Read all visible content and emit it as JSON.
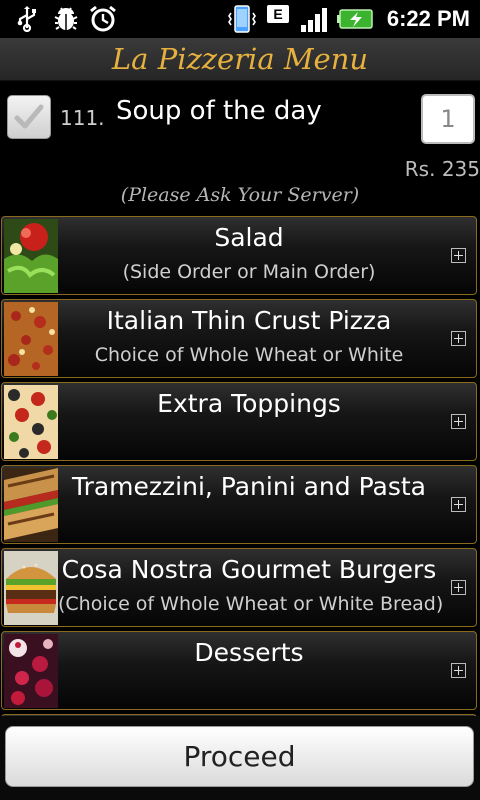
{
  "status_bar": {
    "time": "6:22 PM",
    "left_icons": [
      "usb-icon",
      "debug-bug-icon",
      "alarm-clock-icon"
    ],
    "right_icons": [
      "phone-vibrate-icon",
      "edge-network-icon",
      "signal-icon",
      "battery-charging-icon"
    ],
    "network_letter": "E"
  },
  "header": {
    "title": "La Pizzeria Menu",
    "title_color": "#e6b13e"
  },
  "soup": {
    "checked": true,
    "number": "111.",
    "name": "Soup of the day",
    "quantity": "1",
    "price": "Rs. 235",
    "note": "(Please Ask Your Server)"
  },
  "categories": [
    {
      "title": "Salad",
      "subtitle": "(Side Order or Main Order)"
    },
    {
      "title": "Italian Thin Crust Pizza",
      "subtitle": "Choice of Whole Wheat or White"
    },
    {
      "title": "Extra Toppings",
      "subtitle": ""
    },
    {
      "title": "Tramezzini, Panini and Pasta",
      "subtitle": ""
    },
    {
      "title": "Cosa Nostra Gourmet Burgers",
      "subtitle": "(Choice of Whole Wheat or White Bread)"
    },
    {
      "title": "Desserts",
      "subtitle": ""
    }
  ],
  "footer": {
    "proceed_label": "Proceed"
  }
}
